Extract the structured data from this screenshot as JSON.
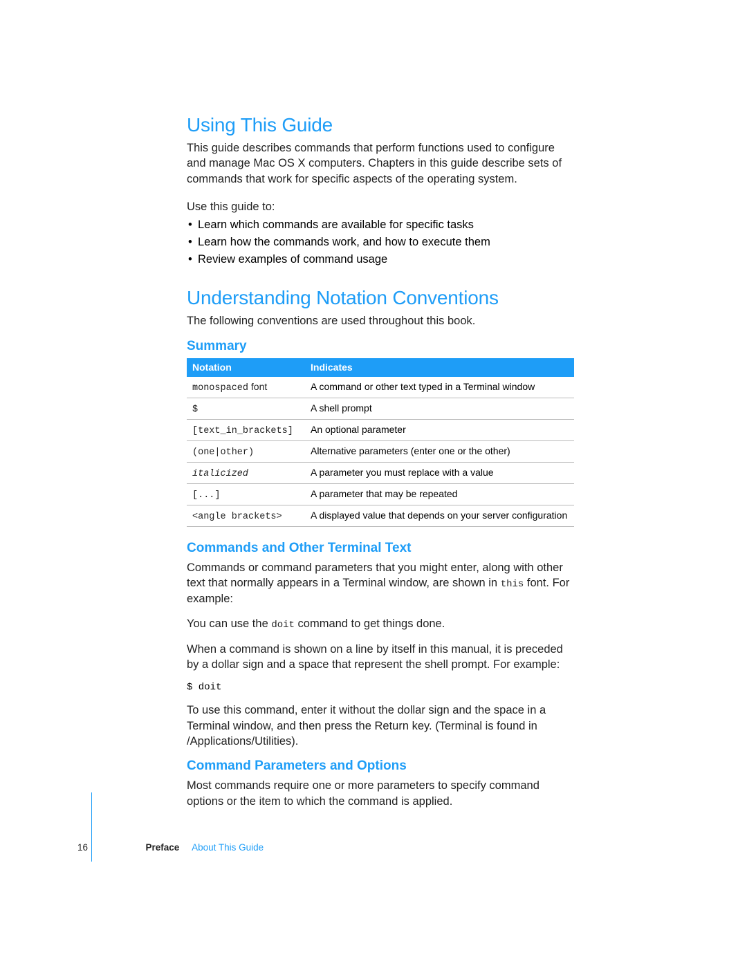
{
  "section1": {
    "heading": "Using This Guide",
    "intro": "This guide describes commands that perform functions used to configure and manage Mac OS X computers. Chapters in this guide describe sets of commands that work for specific aspects of the operating system.",
    "use_lead": "Use this guide to:",
    "bullets": [
      "Learn which commands are available for specific tasks",
      "Learn how the commands work, and how to execute them",
      "Review examples of command usage"
    ]
  },
  "section2": {
    "heading": "Understanding Notation Conventions",
    "intro": "The following conventions are used throughout this book.",
    "summary_heading": "Summary",
    "table": {
      "head_notation": "Notation",
      "head_indicates": "Indicates",
      "rows": [
        {
          "notation_code": "monospaced",
          "notation_suffix": " font",
          "indicates": "A command or other text typed in a Terminal window"
        },
        {
          "notation_code": "$",
          "indicates": "A shell prompt"
        },
        {
          "notation_code": "[text_in_brackets]",
          "indicates": "An optional parameter"
        },
        {
          "notation_code": "(one|other)",
          "indicates": "Alternative parameters (enter one or the other)"
        },
        {
          "notation_code": "italicized",
          "italic": true,
          "indicates": "A parameter you must replace with a value"
        },
        {
          "notation_code": "[...]",
          "indicates": "A parameter that may be repeated"
        },
        {
          "notation_code": "<angle brackets>",
          "indicates": "A displayed value that depends on your server configuration"
        }
      ]
    },
    "terminal_heading": "Commands and Other Terminal Text",
    "terminal_p1_a": "Commands or command parameters that you might enter, along with other text that normally appears in a Terminal window, are shown in ",
    "terminal_p1_code": "this",
    "terminal_p1_b": " font. For example:",
    "terminal_p2_a": "You can use the ",
    "terminal_p2_code": "doit",
    "terminal_p2_b": " command to get things done.",
    "terminal_p3": "When a command is shown on a line by itself in this manual, it is preceded by a dollar sign and a space that represent the shell prompt. For example:",
    "terminal_code": "$ doit",
    "terminal_p4": "To use this command, enter it without the dollar sign and the space in a Terminal window, and then press the Return key. (Terminal is found in /Applications/Utilities).",
    "params_heading": "Command Parameters and Options",
    "params_p": "Most commands require one or more parameters to specify command options or the item to which the command is applied."
  },
  "footer": {
    "page_number": "16",
    "preface": "Preface",
    "about": "About This Guide"
  }
}
